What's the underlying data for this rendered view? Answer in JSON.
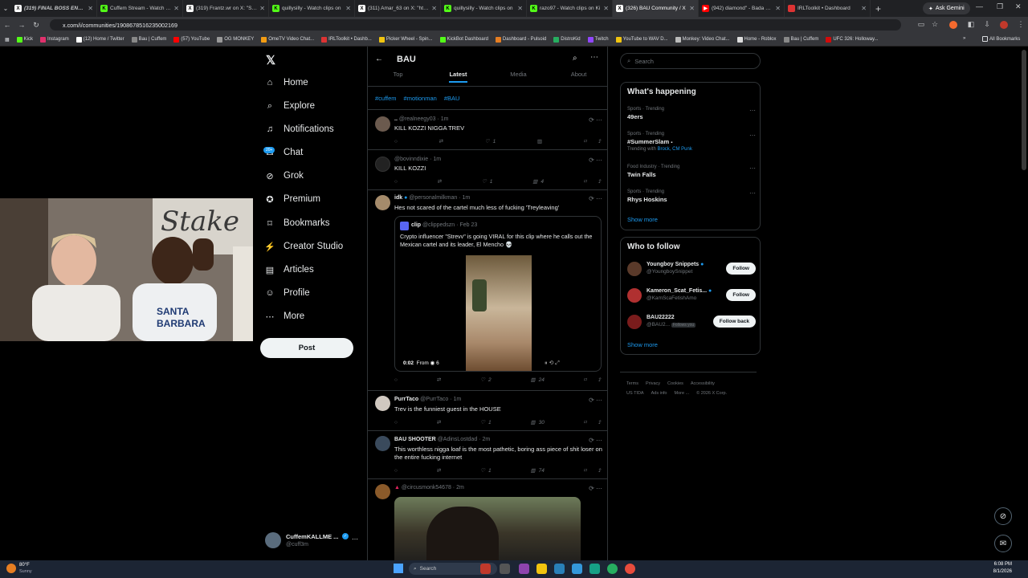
{
  "browser": {
    "tabs": [
      {
        "label": "(319) FINAL BOSS ENGAG",
        "icon": "x-logo-icon",
        "active": false
      },
      {
        "label": "Cuffem Stream - Watch Liv",
        "icon": "kick-logo-icon",
        "active": false
      },
      {
        "label": "(319) Frantz.wr on X: \"Sofia",
        "icon": "x-logo-icon",
        "active": false
      },
      {
        "label": "quillysilly - Watch clips on",
        "icon": "kick-logo-icon",
        "active": false
      },
      {
        "label": "(311) Amar_63 on X: \"https:",
        "icon": "x-logo-icon",
        "active": false
      },
      {
        "label": "quillysilly - Watch clips on",
        "icon": "kick-logo-icon",
        "active": false
      },
      {
        "label": "razo97 - Watch clips on Ki",
        "icon": "kick-logo-icon",
        "active": false
      },
      {
        "label": "(326) BAU Community / X",
        "icon": "x-logo-icon",
        "active": true
      },
      {
        "label": "(942) diamond\" - Bada Bing",
        "icon": "youtube-icon",
        "active": false
      },
      {
        "label": "IRLToolkit • Dashboard",
        "icon": "irltoolkit-icon",
        "active": false
      }
    ],
    "ask_gemini": "Ask Gemini",
    "url": "x.com/i/communities/1908678516235002169",
    "bookmarks": [
      "Kick",
      "Instagram",
      "(12) Home / Twitter",
      "Bau | Cuffem",
      "(57) YouTube",
      "OG MONKEY",
      "OmeTV Video Chat...",
      "IRLToolkit • Dashb...",
      "Picker Wheel - Spin...",
      "KickBot Dashboard",
      "Dashboard - Pulsoid",
      "DistroKid",
      "Twitch",
      "YouTube to WAV D...",
      "Monkey: Video Chat...",
      "Home - Roblox",
      "Bau | Cuffem",
      "UFC 326: Holloway..."
    ],
    "all_bookmarks": "All Bookmarks"
  },
  "nav": {
    "items": [
      {
        "label": "Home",
        "icon": "home-icon"
      },
      {
        "label": "Explore",
        "icon": "search-icon"
      },
      {
        "label": "Notifications",
        "icon": "bell-icon"
      },
      {
        "label": "Chat",
        "icon": "chat-icon",
        "badge": "20+"
      },
      {
        "label": "Grok",
        "icon": "grok-icon"
      },
      {
        "label": "Premium",
        "icon": "premium-icon"
      },
      {
        "label": "Bookmarks",
        "icon": "bookmark-icon"
      },
      {
        "label": "Creator Studio",
        "icon": "creator-studio-icon"
      },
      {
        "label": "Articles",
        "icon": "articles-icon"
      },
      {
        "label": "Profile",
        "icon": "profile-icon"
      },
      {
        "label": "More",
        "icon": "more-icon"
      }
    ],
    "post_label": "Post",
    "account": {
      "name": "CuffemKALLME ...",
      "handle": "@cuff3m"
    }
  },
  "community": {
    "title": "BAU",
    "tabs": [
      "Top",
      "Latest",
      "Media",
      "About"
    ],
    "active_tab": "Latest",
    "hashtags": [
      "#cuffem",
      "#motionman",
      "#BAU"
    ]
  },
  "posts": [
    {
      "name": "..",
      "handle": "@realneegy03",
      "time": "1m",
      "text": "KILL KOZZI NIGGA TREV",
      "likes": "1",
      "views": ""
    },
    {
      "name": "",
      "handle": "@bovinndixie",
      "time": "1m",
      "text": "KILL KOZZI",
      "likes": "1",
      "views": "4"
    },
    {
      "name": "idk",
      "handle": "@personalmilkman",
      "time": "1m",
      "text": "Hes not scared of the cartel much less of fucking 'Treyleaving'",
      "likes": "2",
      "views": "24",
      "quote": {
        "name": "clip",
        "handle": "@clippedszn",
        "time": "Feb 23",
        "text": "Crypto influencer \"Strevv\" is going VIRAL for this clip where he calls out the Mexican cartel and its leader, El Mencho 💀",
        "video_time": "0:02",
        "video_from": "From",
        "video_views": "6"
      }
    },
    {
      "name": "PurrTaco",
      "handle": "@PurrTaco",
      "time": "1m",
      "text": "Trev is the funniest guest in the HOUSE",
      "likes": "1",
      "views": "30"
    },
    {
      "name": "BAU SHOOTER",
      "handle": "@AdinsLostdad",
      "time": "2m",
      "text": "This worthless nigga loaf is the most pathetic, boring ass piece of shit loser on the entire fucking internet",
      "likes": "1",
      "views": "74"
    },
    {
      "name": "",
      "handle": "@circusmonk54678",
      "time": "2m",
      "text": "",
      "likes": "",
      "views": ""
    }
  ],
  "search": {
    "placeholder": "Search"
  },
  "trending": {
    "title": "What's happening",
    "items": [
      {
        "category": "Sports · Trending",
        "topic": "49ers",
        "meta": ""
      },
      {
        "category": "Sports · Trending",
        "topic": "#SummerSlam",
        "meta": "Trending with",
        "meta_links": "Brock, CM Punk"
      },
      {
        "category": "Food Industry · Trending",
        "topic": "Twin Falls",
        "meta": ""
      },
      {
        "category": "Sports · Trending",
        "topic": "Rhys Hoskins",
        "meta": ""
      }
    ],
    "show_more": "Show more"
  },
  "who_to_follow": {
    "title": "Who to follow",
    "items": [
      {
        "name": "Youngboy Snippets",
        "handle": "@YoungboySnippet",
        "button": "Follow"
      },
      {
        "name": "Kameron_Scat_Fetis...",
        "handle": "@KamScaFetishAmo",
        "button": "Follow"
      },
      {
        "name": "BAU22222",
        "handle": "@BAU2...",
        "follows_you": "Follows you",
        "button": "Follow back"
      }
    ],
    "show_more": "Show more"
  },
  "footer": {
    "row1": [
      "Terms",
      "Privacy",
      "Cookies",
      "Accessibility"
    ],
    "row2": [
      "US TIDA",
      "Ads info",
      "More ...",
      "© 2026 X Corp."
    ]
  },
  "taskbar": {
    "weather_temp": "80°F",
    "weather_desc": "Sunny",
    "search": "Search",
    "time": "6:08 PM",
    "date": "8/1/2026"
  },
  "colors": {
    "accent": "#1d9bf0",
    "bg": "#000000",
    "border": "#2f3336",
    "muted": "#71767b"
  }
}
